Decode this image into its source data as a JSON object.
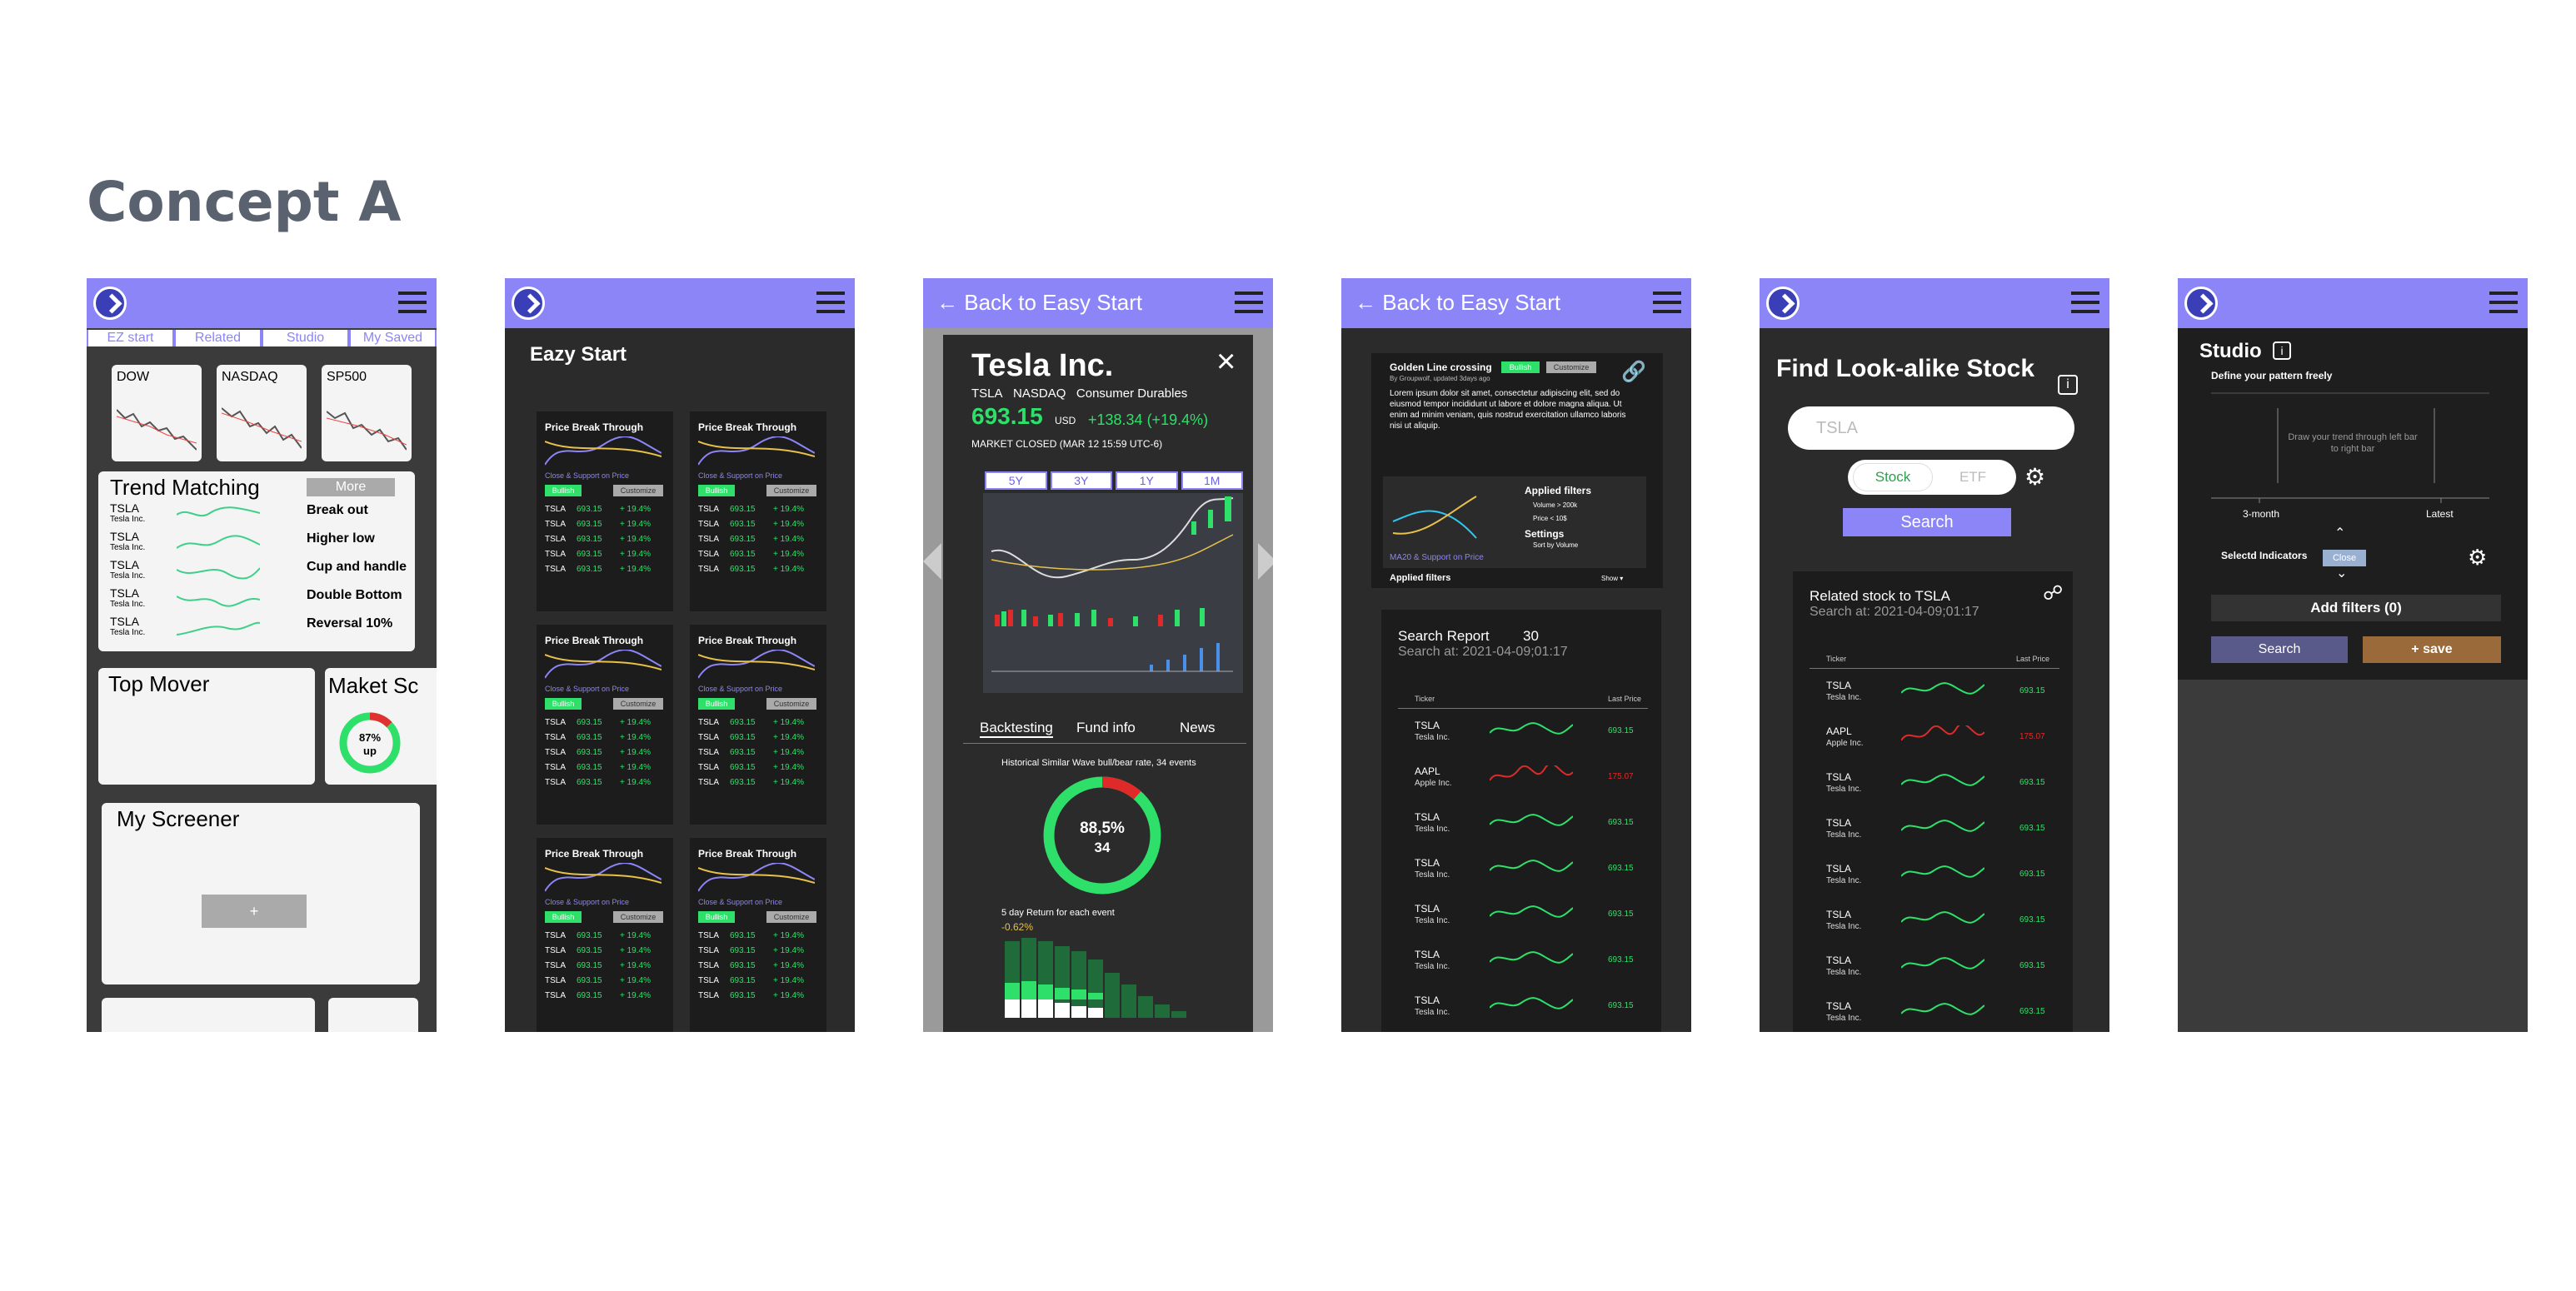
{
  "heading": "Concept A",
  "s1": {
    "tabs": [
      "EZ start",
      "Related",
      "Studio",
      "My Saved"
    ],
    "indices": [
      "DOW",
      "NASDAQ",
      "SP500"
    ],
    "trend_title": "Trend Matching",
    "more": "More",
    "tickers": [
      "TSLA",
      "TSLA",
      "TSLA",
      "TSLA",
      "TSLA"
    ],
    "ticker_sub": "Tesla Inc.",
    "patterns": [
      "Break out",
      "Higher low",
      "Cup and handle",
      "Double Bottom",
      "Reversal 10%"
    ],
    "top_mover": "Top Mover",
    "market": "Maket Sc",
    "gauge_pct": "87%",
    "gauge_word": "up",
    "screener": "My Screener",
    "add": "+"
  },
  "s2": {
    "title": "Eazy Start",
    "card_title": "Price Break Through",
    "card_sub": "Close & Support on Price",
    "bull": "Bullish",
    "customize": "Customize",
    "row_ticker": "TSLA",
    "row_price": "693.15",
    "row_change": "+ 19.4%"
  },
  "s3": {
    "back": "Back to Easy Start",
    "company": "Tesla Inc.",
    "ticker": "TSLA",
    "exchange": "NASDAQ",
    "sector": "Consumer Durables",
    "price": "693.15",
    "currency": "USD",
    "change": "+138.34 (+19.4%)",
    "status": "MARKET CLOSED (MAR 12 15:59 UTC-6)",
    "ranges": [
      "5Y",
      "3Y",
      "1Y",
      "1M"
    ],
    "tabs": [
      "Backtesting",
      "Fund info",
      "News"
    ],
    "hist_label": "Historical Similar Wave bull/bear rate, 34 events",
    "ring_pct": "88,5%",
    "ring_n": "34",
    "return_label": "5 day Return for each event",
    "return_val": "-0.62%"
  },
  "s4": {
    "back": "Back to Easy Start",
    "card_title": "Golden Line crossing",
    "bull": "Bullish",
    "customize": "Customize",
    "byline": "By Groupwolf, updated 3days ago",
    "lorem": "Lorem ipsum dolor sit amet, consectetur adipiscing elit, sed do eiusmod tempor incididunt ut labore et dolore magna aliqua. Ut enim ad minim veniam, quis nostrud exercitation ullamco laboris nisi ut aliquip.",
    "chart_cap": "MA20 & Support on Price",
    "applied": "Applied filters",
    "f1": "Volume > 200k",
    "f2": "Price < 10$",
    "settings": "Settings",
    "sort": "Sort by Volume",
    "applied2": "Applied filters",
    "show": "Show",
    "report": "Search Report",
    "report_n": "30",
    "search_at": "Search at: 2021-04-09;01:17",
    "col_ticker": "Ticker",
    "col_last": "Last Price",
    "rows": [
      {
        "t": "TSLA",
        "n": "Tesla Inc.",
        "p": "693.15",
        "up": true
      },
      {
        "t": "AAPL",
        "n": "Apple Inc.",
        "p": "175.07",
        "up": false
      },
      {
        "t": "TSLA",
        "n": "Tesla Inc.",
        "p": "693.15",
        "up": true
      },
      {
        "t": "TSLA",
        "n": "Tesla Inc.",
        "p": "693.15",
        "up": true
      },
      {
        "t": "TSLA",
        "n": "Tesla Inc.",
        "p": "693.15",
        "up": true
      },
      {
        "t": "TSLA",
        "n": "Tesla Inc.",
        "p": "693.15",
        "up": true
      },
      {
        "t": "TSLA",
        "n": "Tesla Inc.",
        "p": "693.15",
        "up": true
      }
    ]
  },
  "s5": {
    "title": "Find Look-alike Stock",
    "search_placeholder": "TSLA",
    "stock": "Stock",
    "etf": "ETF",
    "search": "Search",
    "related": "Related stock to TSLA",
    "search_at": "Search at: 2021-04-09;01:17",
    "col_ticker": "Ticker",
    "col_last": "Last Price",
    "rows": [
      {
        "t": "TSLA",
        "n": "Tesla Inc.",
        "p": "693.15",
        "up": true
      },
      {
        "t": "AAPL",
        "n": "Apple Inc.",
        "p": "175.07",
        "up": false
      },
      {
        "t": "TSLA",
        "n": "Tesla Inc.",
        "p": "693.15",
        "up": true
      },
      {
        "t": "TSLA",
        "n": "Tesla Inc.",
        "p": "693.15",
        "up": true
      },
      {
        "t": "TSLA",
        "n": "Tesla Inc.",
        "p": "693.15",
        "up": true
      },
      {
        "t": "TSLA",
        "n": "Tesla Inc.",
        "p": "693.15",
        "up": true
      },
      {
        "t": "TSLA",
        "n": "Tesla Inc.",
        "p": "693.15",
        "up": true
      },
      {
        "t": "TSLA",
        "n": "Tesla Inc.",
        "p": "693.15",
        "up": true
      }
    ]
  },
  "s6": {
    "title": "Studio",
    "define": "Define your pattern freely",
    "draw": "Draw your trend through left bar to right bar",
    "x_left": "3-month",
    "x_right": "Latest",
    "indicators": "Selectd Indicators",
    "close": "Close",
    "add_filters": "Add filters (0)",
    "search": "Search",
    "save": "+ save"
  }
}
